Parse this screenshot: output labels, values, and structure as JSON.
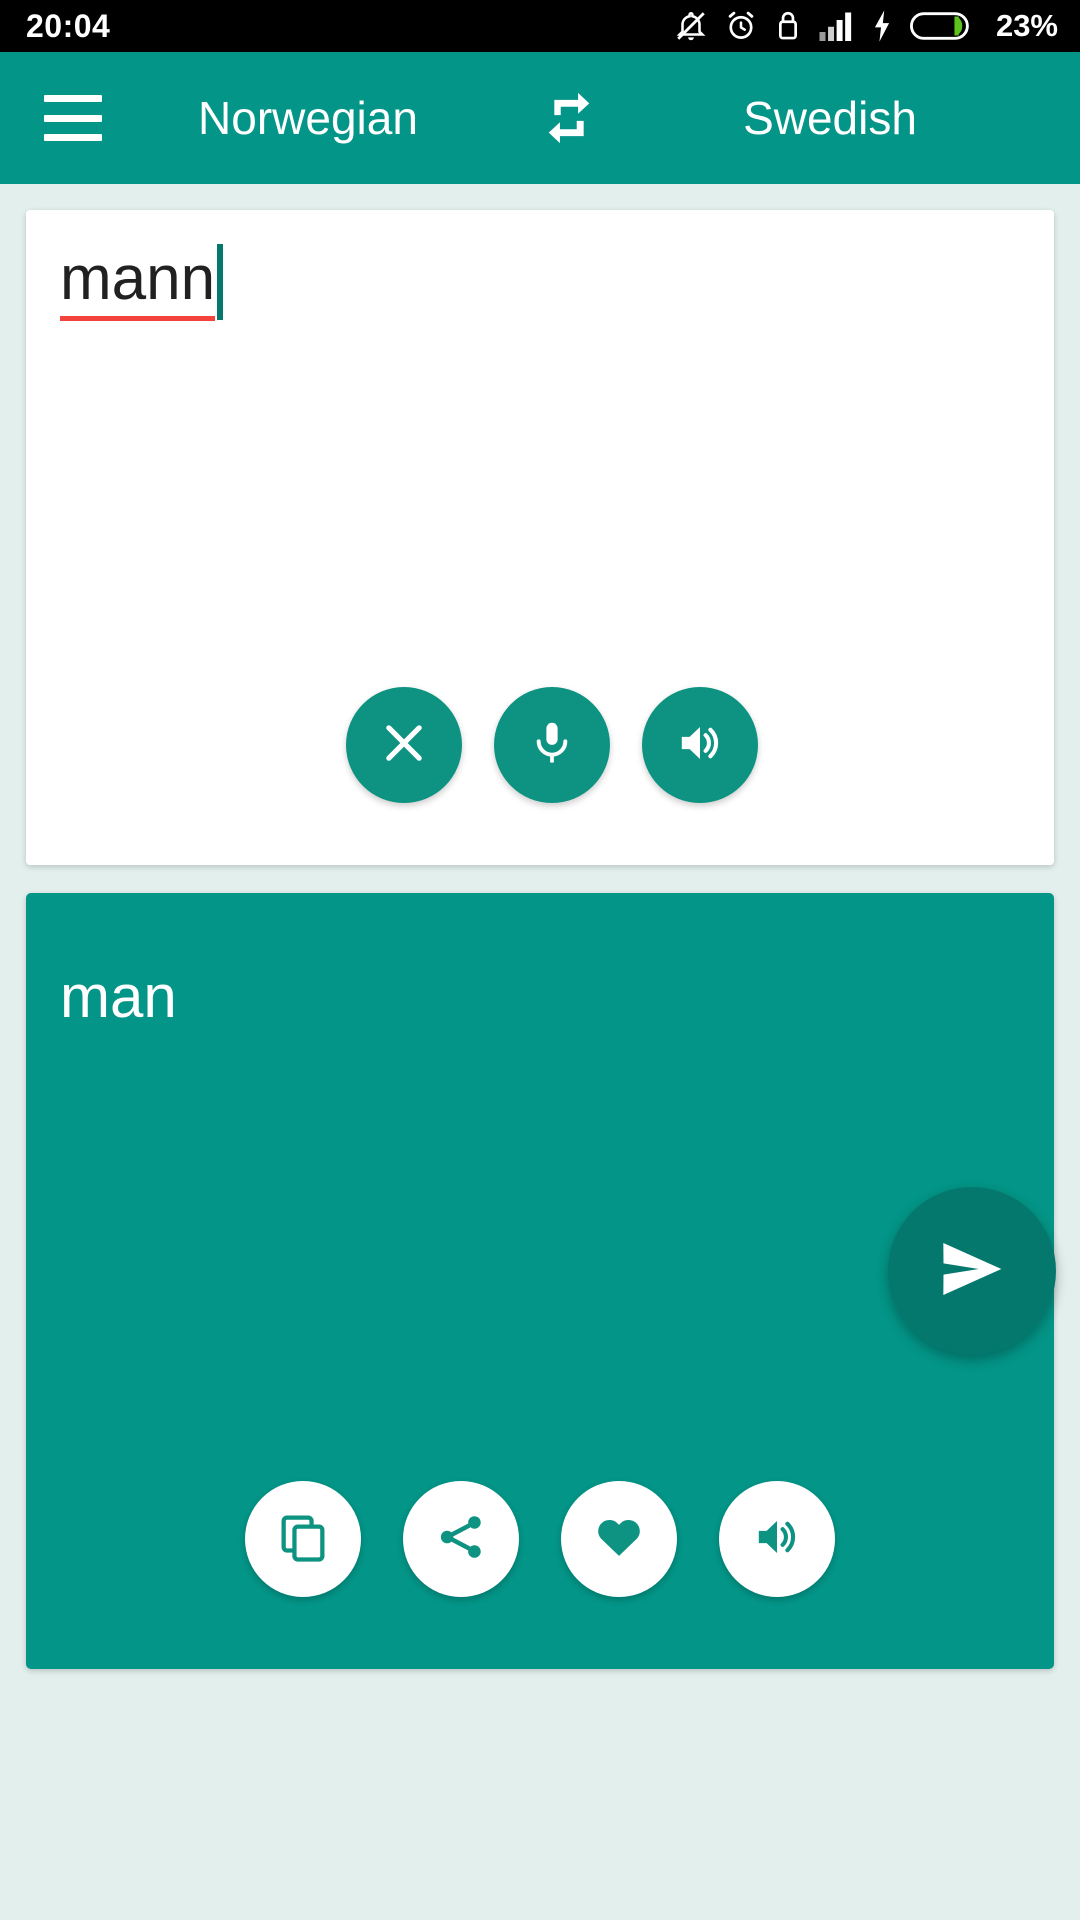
{
  "status_bar": {
    "time": "20:04",
    "battery_percent": "23%",
    "icons": [
      "notifications-off-icon",
      "alarm-clock-icon",
      "screen-lock-icon",
      "signal-bars-icon",
      "charging-bolt-icon",
      "battery-icon"
    ]
  },
  "app_bar": {
    "menu_icon": "hamburger-menu-icon",
    "source_language": "Norwegian",
    "swap_icon": "swap-languages-icon",
    "target_language": "Swedish"
  },
  "source_card": {
    "text": "mann",
    "spellcheck_underline": true,
    "actions": [
      {
        "name": "clear-button",
        "icon": "close-icon",
        "label": "Clear"
      },
      {
        "name": "voice-input-button",
        "icon": "microphone-icon",
        "label": "Speak"
      },
      {
        "name": "listen-source-button",
        "icon": "speaker-icon",
        "label": "Listen"
      }
    ]
  },
  "send_button": {
    "icon": "send-icon",
    "label": "Translate"
  },
  "result_card": {
    "text": "man",
    "actions": [
      {
        "name": "copy-button",
        "icon": "copy-icon",
        "label": "Copy"
      },
      {
        "name": "share-button",
        "icon": "share-icon",
        "label": "Share"
      },
      {
        "name": "favorite-button",
        "icon": "heart-icon",
        "label": "Favorite"
      },
      {
        "name": "listen-result-button",
        "icon": "speaker-icon",
        "label": "Listen"
      }
    ]
  },
  "colors": {
    "primary_teal": "#039587",
    "button_teal": "#0e9382",
    "fab_teal": "#04786d",
    "page_background": "#e2efed",
    "card_white": "#ffffff",
    "status_bar_black": "#000000",
    "spellcheck_red": "#f4433c",
    "battery_green": "#5dc21e"
  }
}
